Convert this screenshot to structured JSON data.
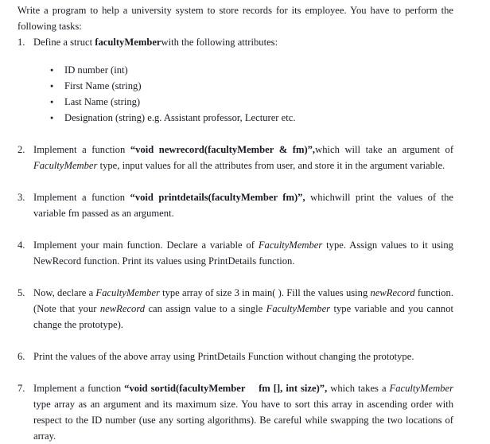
{
  "document": {
    "intro": "Write a program to help a university system to store records for its employee. You have to perform the following tasks:",
    "bullet_glyph": "●",
    "tasks": [
      {
        "number": "1.",
        "segments": [
          {
            "text": "Define a struct ",
            "style": "normal"
          },
          {
            "text": "facultyMember",
            "style": "bold"
          },
          {
            "text": "with the following attributes:",
            "style": "normal"
          }
        ],
        "attributes": [
          "ID number (int)",
          "First Name (string)",
          "Last Name (string)",
          "Designation (string) e.g. Assistant professor, Lecturer etc."
        ]
      },
      {
        "number": "2.",
        "segments": [
          {
            "text": "Implement a function ",
            "style": "normal"
          },
          {
            "text": "“void newrecord(facultyMember & fm)”,",
            "style": "bold"
          },
          {
            "text": "which will take an argument of ",
            "style": "normal"
          },
          {
            "text": "FacultyMember",
            "style": "italic"
          },
          {
            "text": " type, input values for all the attributes from user, and store it in the argument variable.",
            "style": "normal"
          }
        ]
      },
      {
        "number": "3.",
        "segments": [
          {
            "text": "Implement a function ",
            "style": "normal"
          },
          {
            "text": "“void printdetails(facultyMember fm)”,",
            "style": "bold"
          },
          {
            "text": " whichwill print the values of the variable fm passed as an argument.",
            "style": "normal"
          }
        ]
      },
      {
        "number": "4.",
        "segments": [
          {
            "text": "Implement your main function. Declare a variable of ",
            "style": "normal"
          },
          {
            "text": "FacultyMember",
            "style": "italic"
          },
          {
            "text": " type. Assign values to it using NewRecord function. Print its values using PrintDetails function.",
            "style": "normal"
          }
        ]
      },
      {
        "number": "5.",
        "segments": [
          {
            "text": "Now, declare a ",
            "style": "normal"
          },
          {
            "text": "FacultyMember",
            "style": "italic"
          },
          {
            "text": " type array of size 3 in main( ). Fill the values using ",
            "style": "normal"
          },
          {
            "text": "newRecord",
            "style": "italic"
          },
          {
            "text": " function. (Note that your ",
            "style": "normal"
          },
          {
            "text": "newRecord",
            "style": "italic"
          },
          {
            "text": " can assign value to a single ",
            "style": "normal"
          },
          {
            "text": "FacultyMember",
            "style": "italic"
          },
          {
            "text": " type variable and you cannot change the prototype).",
            "style": "normal"
          }
        ]
      },
      {
        "number": "6.",
        "segments": [
          {
            "text": "Print the values of the above array using PrintDetails Function without changing the prototype.",
            "style": "normal"
          }
        ]
      },
      {
        "number": "7.",
        "segments": [
          {
            "text": "Implement a function ",
            "style": "normal"
          },
          {
            "text": "“void sortid(facultyMember  fm [], int size)”,",
            "style": "bold"
          },
          {
            "text": " which takes a ",
            "style": "normal"
          },
          {
            "text": "FacultyMember",
            "style": "italic"
          },
          {
            "text": " type array as an argument and its maximum size. You have to sort this array in ascending order with respect to the ID number (use any sorting algorithms). Be careful while swapping the two locations of array.",
            "style": "normal"
          }
        ]
      }
    ]
  }
}
